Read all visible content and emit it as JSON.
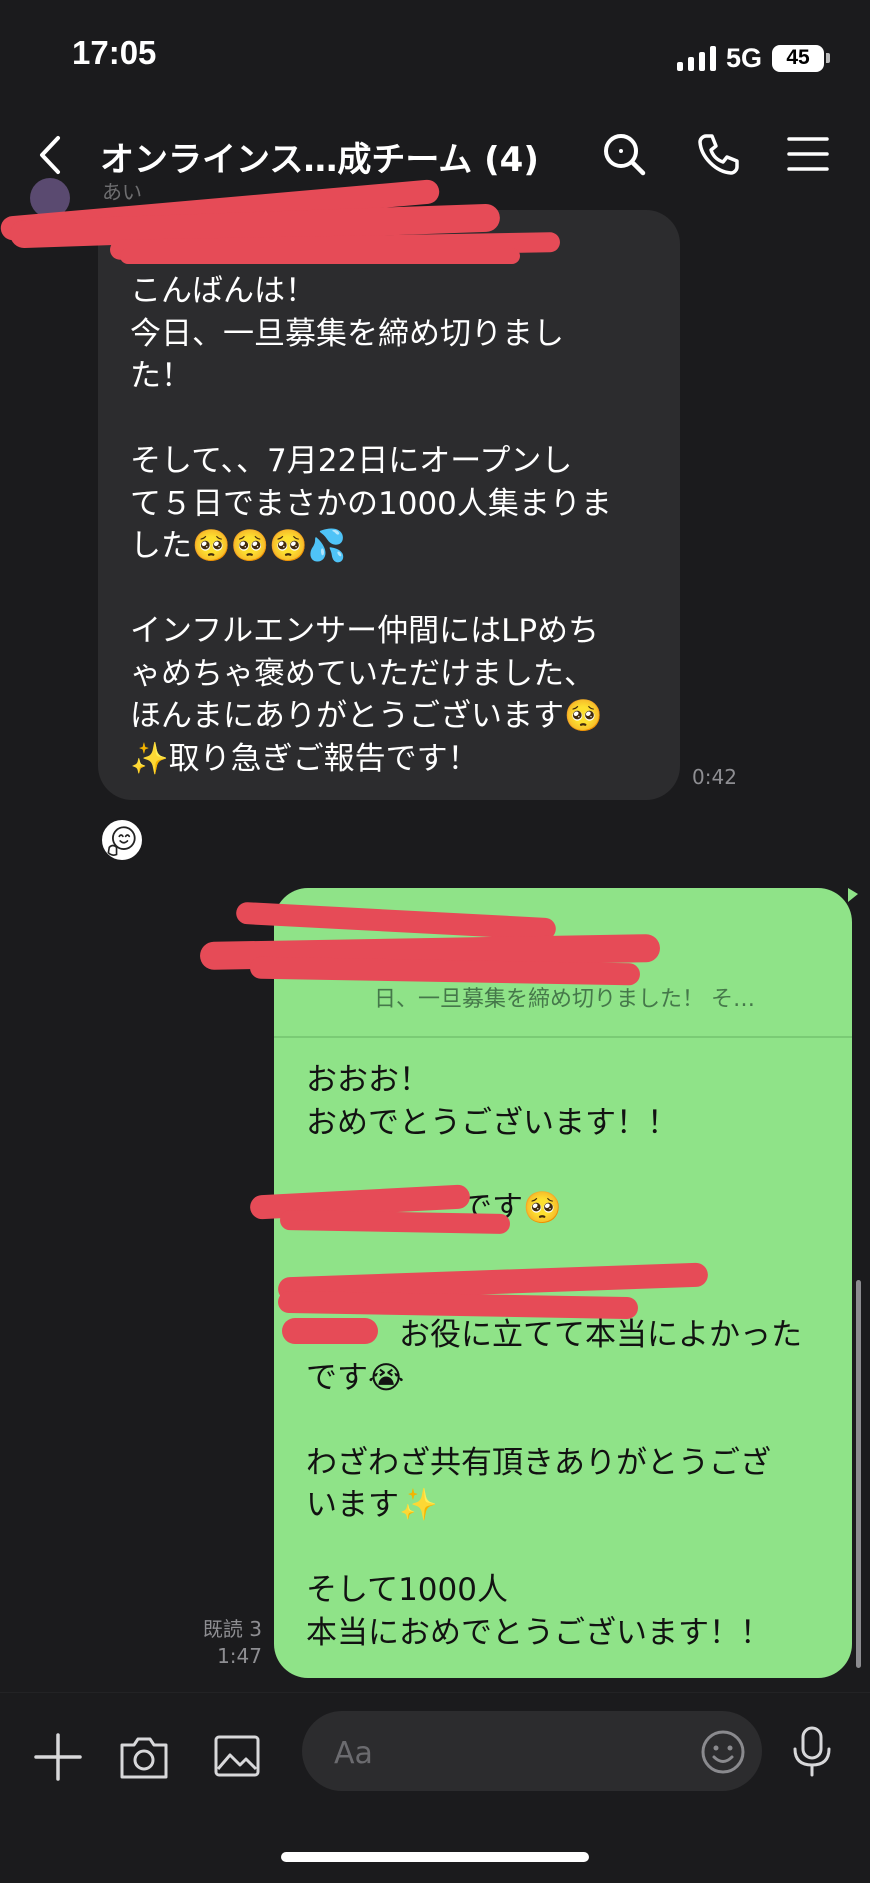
{
  "status_bar": {
    "time": "17:05",
    "network": "5G",
    "battery": "45",
    "icons": [
      "signal-bars-icon",
      "battery-icon"
    ]
  },
  "header": {
    "title": "オンラインス…成チーム (4)",
    "icons": [
      "back-icon",
      "search-icon",
      "phone-icon",
      "menu-icon"
    ]
  },
  "incoming_message": {
    "sender_name": "あい",
    "text": "こんばんは！\n今日、一旦募集を締め切りまし\nた！\n\nそして、、7月22日にオープンし\nて５日でまさかの1000人集まりま\nした🥺🥺🥺💦\n\nインフルエンサー仲間にはLPめち\nゃめちゃ褒めていただけました、\nほんまにありがとうございます🥺\n✨取り急ぎご報告です！",
    "time": "0:42",
    "reaction_icon": "smile-sticker-icon"
  },
  "outgoing_message": {
    "reply_quote": "んばんは！ 今\n日、一旦募集を締め切りました！ そ…",
    "text": "おおお！\nおめでとうございます！！\n\n　　　　　です🥺\n\n\n　　　お役に立てて本当によかった\nです😭\n\nわざわざ共有頂きありがとうござ\nいます✨\n\nそして1000人\n本当におめでとうございます！！",
    "read_label": "既読 3",
    "time": "1:47",
    "bubble_color": "#8fe388"
  },
  "input_bar": {
    "placeholder": "Aa",
    "icons": [
      "plus-icon",
      "camera-icon",
      "image-icon",
      "emoji-icon",
      "mic-icon"
    ]
  },
  "colors": {
    "background": "#1b1b1d",
    "incoming_bubble": "#2c2c2e",
    "redaction": "#e64b57"
  }
}
